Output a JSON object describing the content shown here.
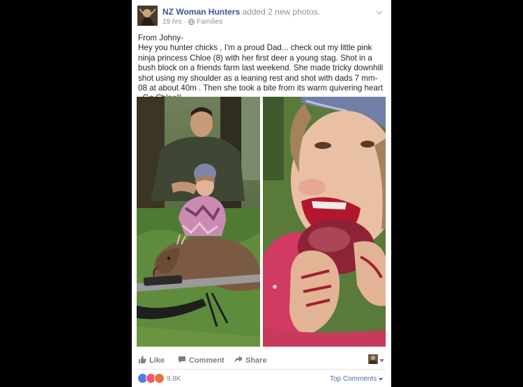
{
  "post": {
    "author": "NZ Woman Hunters",
    "action": "added 2 new photos.",
    "time": "19 hrs",
    "separator": "·",
    "audience": "Families",
    "text_line1": "From Johny-",
    "text_body": "Hey you hunter chicks , I'm a proud Dad... check out my little pink ninja princess Chloe (8) with her first deer a young stag. Shot in a bush block on a friends farm last weekend. She made tricky downhill shot using my shoulder as a leaning rest and shot with dads 7 mm-08 at about 40m . Then she took a bite from its warm quivering heart , Go Chloe!!"
  },
  "actions": {
    "like": "Like",
    "comment": "Comment",
    "share": "Share"
  },
  "reactions": {
    "count": "9.8K",
    "top_comments": "Top Comments",
    "icons": [
      "like-icon",
      "love-icon",
      "angry-icon"
    ]
  },
  "colors": {
    "link": "#365899",
    "muted": "#90949c",
    "text": "#1d2129",
    "backdrop": "#000000"
  }
}
